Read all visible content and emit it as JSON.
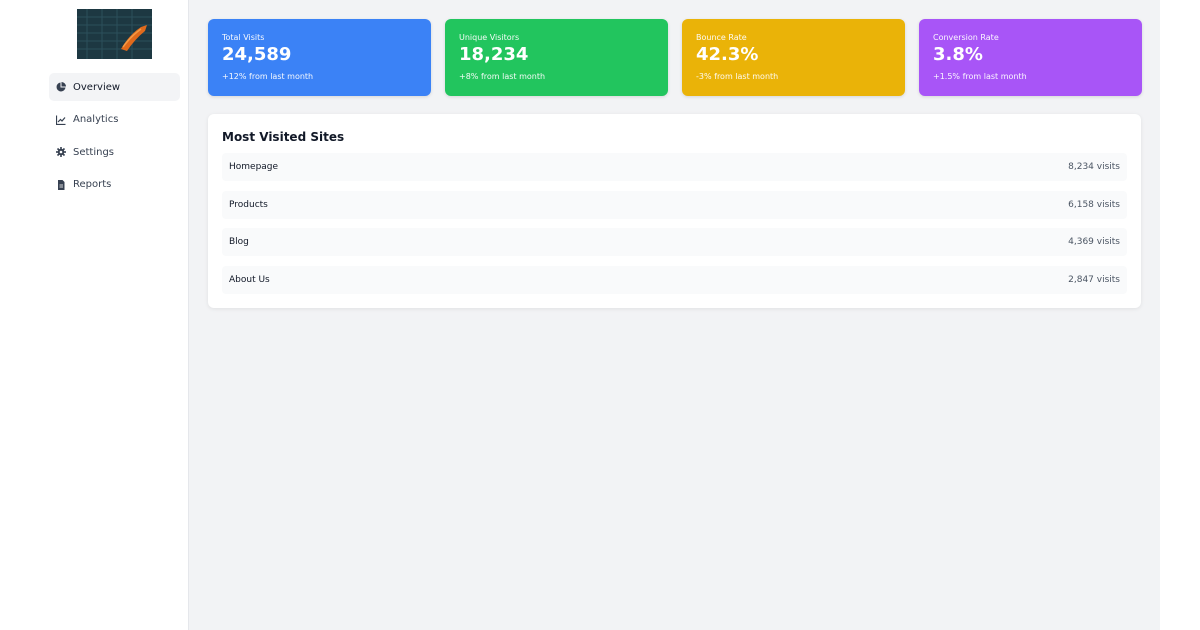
{
  "sidebar": {
    "logo_icon": "thumbnail-image",
    "items": [
      {
        "label": "Overview",
        "icon": "pie-chart-icon",
        "active": true
      },
      {
        "label": "Analytics",
        "icon": "line-chart-icon",
        "active": false
      },
      {
        "label": "Settings",
        "icon": "gear-icon",
        "active": false
      },
      {
        "label": "Reports",
        "icon": "document-icon",
        "active": false
      }
    ]
  },
  "stats": [
    {
      "label": "Total Visits",
      "value": "24,589",
      "change": "+12% from last month",
      "color": "#3b82f6"
    },
    {
      "label": "Unique Visitors",
      "value": "18,234",
      "change": "+8% from last month",
      "color": "#22c55e"
    },
    {
      "label": "Bounce Rate",
      "value": "42.3%",
      "change": "-3% from last month",
      "color": "#eab308"
    },
    {
      "label": "Conversion Rate",
      "value": "3.8%",
      "change": "+1.5% from last month",
      "color": "#a855f7"
    }
  ],
  "sites": {
    "title": "Most Visited Sites",
    "rows": [
      {
        "name": "Homepage",
        "visits": "8,234 visits"
      },
      {
        "name": "Products",
        "visits": "6,158 visits"
      },
      {
        "name": "Blog",
        "visits": "4,369 visits"
      },
      {
        "name": "About Us",
        "visits": "2,847 visits"
      }
    ]
  }
}
